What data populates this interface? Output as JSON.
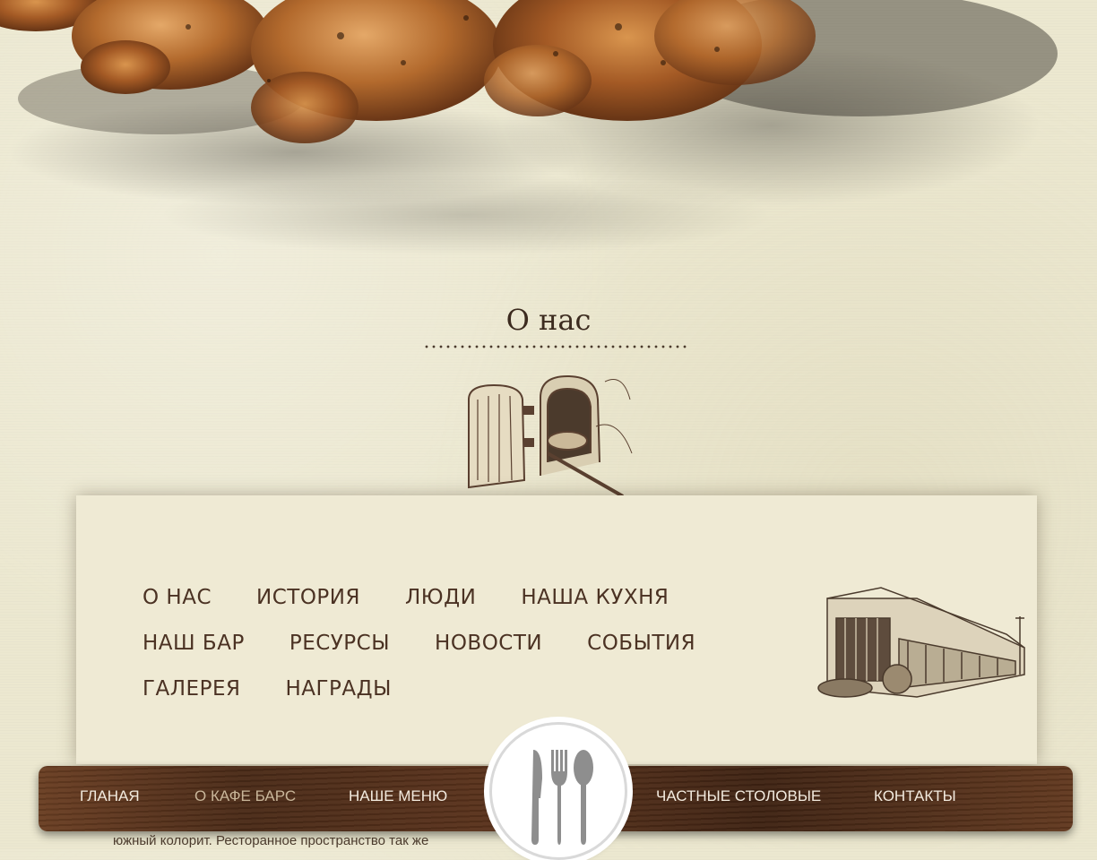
{
  "section": {
    "title": "О нас"
  },
  "submenu": {
    "rows": [
      [
        "О НАС",
        "ИСТОРИЯ",
        "ЛЮДИ",
        "НАША КУХНЯ"
      ],
      [
        "НАШ БАР",
        "РЕСУРСЫ",
        "НОВОСТИ",
        "СОБЫТИЯ"
      ],
      [
        "ГАЛЕРЕЯ",
        "НАГРАДЫ"
      ]
    ]
  },
  "nav": {
    "items": [
      {
        "label": "ГЛАНАЯ",
        "active": false
      },
      {
        "label": "О КАФЕ БАРС",
        "active": true
      },
      {
        "label": "НАШЕ МЕНЮ",
        "active": false
      },
      {
        "label": "ЧАСТНЫЕ СТОЛОВЫЕ",
        "active": false
      },
      {
        "label": "КОНТАКТЫ",
        "active": false
      }
    ],
    "logo_icon": "cutlery-icon"
  },
  "bottom": {
    "text": "южный колорит. Ресторанное пространство так же"
  },
  "colors": {
    "paper": "#ece8d0",
    "text_dark": "#4b3223",
    "wood": "#4a2a17",
    "nav_text": "#f3ebdf",
    "nav_active": "#c9b69a"
  }
}
